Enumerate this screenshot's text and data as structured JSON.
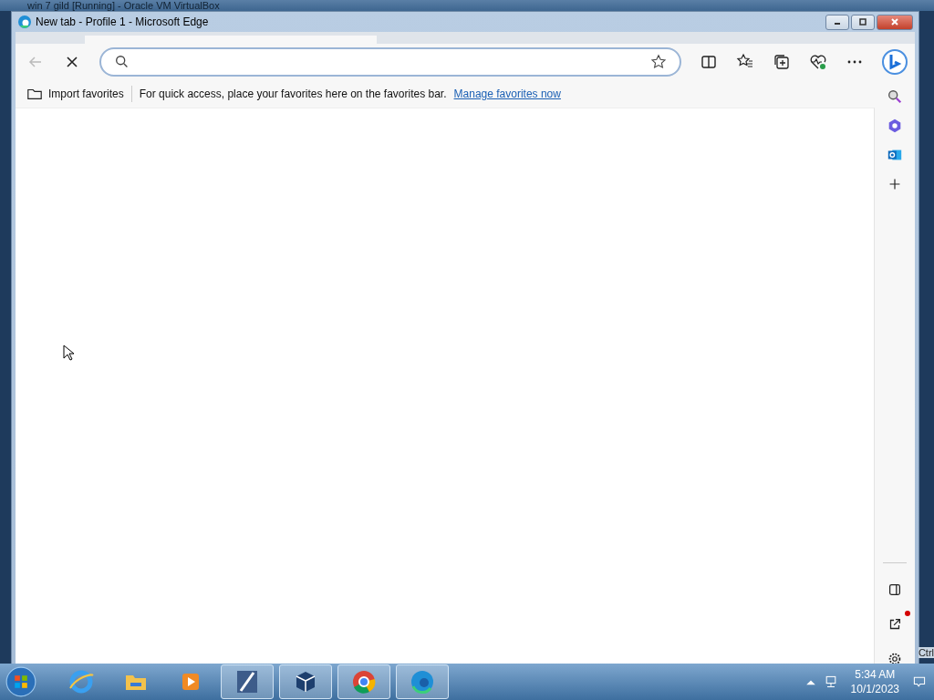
{
  "vm_window": {
    "title": "win 7 gild [Running] - Oracle VM VirtualBox",
    "host_key": "Ctrl"
  },
  "browser": {
    "title": "New tab - Profile 1 - Microsoft Edge",
    "loading": true,
    "favorites_bar": {
      "import": "Import favorites",
      "hint": "For quick access, place your favorites here on the favorites bar.",
      "link": "Manage favorites now"
    },
    "sidebar": [
      {
        "kind": "search"
      },
      {
        "kind": "copilot"
      },
      {
        "kind": "outlook"
      },
      {
        "kind": "add"
      }
    ],
    "sidebar_bottom": [
      {
        "kind": "panel",
        "dot": false
      },
      {
        "kind": "external",
        "dot": true
      },
      {
        "kind": "settings",
        "dot": false
      }
    ]
  },
  "taskbar": {
    "apps": [
      {
        "kind": "ie",
        "running": false
      },
      {
        "kind": "folder",
        "running": false
      },
      {
        "kind": "media",
        "running": false
      },
      {
        "kind": "tool",
        "running": true
      },
      {
        "kind": "cube",
        "running": true
      },
      {
        "kind": "chrome",
        "running": true
      },
      {
        "kind": "edge",
        "running": true
      }
    ],
    "time": "5:34 AM",
    "date": "10/1/2023"
  }
}
